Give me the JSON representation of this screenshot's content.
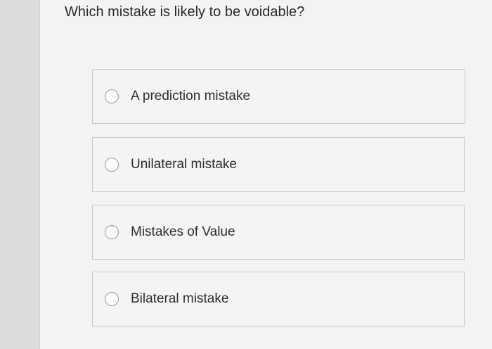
{
  "question": {
    "text": "Which mistake is likely to be voidable?"
  },
  "options": [
    {
      "label": "A prediction mistake",
      "selected": false
    },
    {
      "label": "Unilateral mistake",
      "selected": false
    },
    {
      "label": "Mistakes of Value",
      "selected": false
    },
    {
      "label": "Bilateral mistake",
      "selected": false
    }
  ]
}
